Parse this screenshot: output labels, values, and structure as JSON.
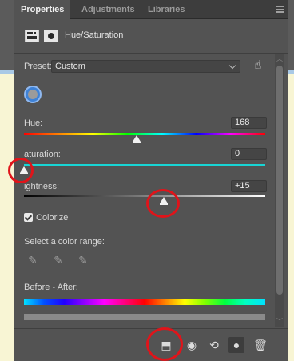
{
  "tabs": [
    {
      "label": "Properties",
      "active": true
    },
    {
      "label": "Adjustments",
      "active": false
    },
    {
      "label": "Libraries",
      "active": false
    }
  ],
  "header": {
    "title": "Hue/Saturation"
  },
  "preset": {
    "label": "Preset:",
    "value": "Custom"
  },
  "hue": {
    "label": "Hue:",
    "value": "168"
  },
  "saturation": {
    "label": "aturation:",
    "value": "0"
  },
  "lightness": {
    "label": "ightness:",
    "value": "+15"
  },
  "colorize": {
    "label": "Colorize",
    "checked": true
  },
  "color_range": {
    "label": "Select a color range:"
  },
  "before_after": {
    "label": "Before - After:"
  },
  "icons": {
    "panel_menu": "hamburger-menu-icon",
    "adjustment_layer": "adjustment-layer-icon",
    "mask": "mask-icon",
    "targeted_adjustment": "hand-pointer-icon",
    "sample": "color-sample-icon",
    "eyedroppers": [
      "eyedropper-icon",
      "eyedropper-plus-icon",
      "eyedropper-minus-icon"
    ],
    "bottom": [
      "clip-to-layer-icon",
      "view-previous-state-icon",
      "reset-icon",
      "visibility-eye-icon",
      "trash-icon"
    ]
  },
  "colors": {
    "panel_bg": "#535353",
    "tab_bar_bg": "#3d3d3d",
    "field_bg": "#454545",
    "annotation_red": "#e0141a",
    "sample_blue": "#3e82d7"
  }
}
